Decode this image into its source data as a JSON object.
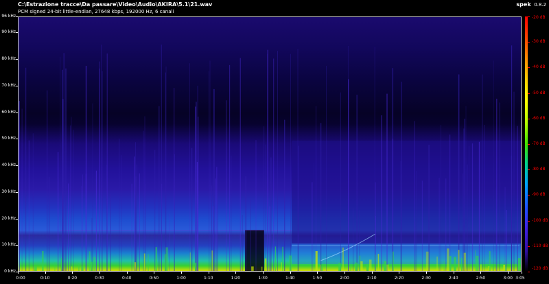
{
  "header": {
    "file_path": "C:\\Estrazione tracce\\Da passare\\Video\\Audio\\AKIRA\\5.1\\21.wav",
    "file_info": "PCM signed 24-bit little-endian, 27648 kbps, 192000 Hz, 6 canali",
    "app_name": "spek",
    "app_version": "0.8.2"
  },
  "frequency_axis": {
    "unit": "kHz",
    "max": 96,
    "ticks": [
      "0 kHz",
      "10 kHz",
      "20 kHz",
      "30 kHz",
      "40 kHz",
      "50 kHz",
      "60 kHz",
      "70 kHz",
      "80 kHz",
      "90 kHz",
      "96 kHz"
    ],
    "values": [
      0,
      10,
      20,
      30,
      40,
      50,
      60,
      70,
      80,
      90,
      96
    ]
  },
  "time_axis": {
    "duration_seconds": 185,
    "ticks": [
      "0:00",
      "0:10",
      "0:20",
      "0:30",
      "0:40",
      "0:50",
      "1:00",
      "1:10",
      "1:20",
      "1:30",
      "1:40",
      "1:50",
      "2:00",
      "2:10",
      "2:20",
      "2:30",
      "2:40",
      "2:50",
      "3:00",
      "3:05"
    ],
    "values": [
      0,
      10,
      20,
      30,
      40,
      50,
      60,
      70,
      80,
      90,
      100,
      110,
      120,
      130,
      140,
      150,
      160,
      170,
      180,
      185
    ]
  },
  "colorbar": {
    "unit": "dB",
    "min": -120,
    "max": -20,
    "ticks": [
      "-20 dB",
      "-30 dB",
      "-40 dB",
      "-50 dB",
      "-60 dB",
      "-70 dB",
      "-80 dB",
      "-90 dB",
      "-100 dB",
      "-110 dB",
      "-120 dB"
    ],
    "values": [
      -20,
      -30,
      -40,
      -50,
      -60,
      -70,
      -80,
      -90,
      -100,
      -110,
      -120
    ]
  },
  "colors": {
    "background": "#000000",
    "axis": "#ffffff",
    "colorbar_labels": "#ff0000"
  }
}
